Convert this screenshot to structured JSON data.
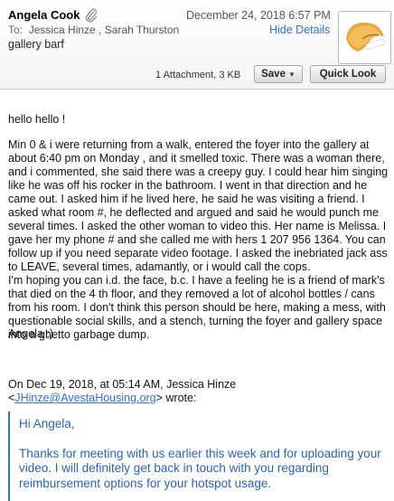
{
  "header": {
    "sender": "Angela Cook",
    "date": "December 24, 2018  6:57 PM",
    "to_label": "To:",
    "recipients": "Jessica Hinze ,  Sarah Thurston",
    "hide_details": "Hide Details",
    "subject": "gallery barf",
    "attachment_info": "1 Attachment, 3 KB",
    "save_label": "Save",
    "quick_look_label": "Quick Look",
    "icons": [
      "paperclip-icon",
      "fortune-cookie-avatar",
      "chevron-down-icon"
    ]
  },
  "body": {
    "greeting": "hello hello !",
    "paragraph1": "Min 0 & i were returning from a walk, entered the foyer into the gallery at about 6:40 pm on Monday , and it smelled toxic. There was a woman there, and i commented, she said there was a creepy guy. I could hear him singing like he was off his rocker in the bathroom. I went in that direction and he came out. I asked him if he lived here, he said he was visiting a friend. I asked what room #, he deflected and argued and said he would punch me several times. I asked the other woman to video this. Her name is Melissa. I gave her my phone # and she called me with hers 1 207 956 1364. You can follow up if you need separate video footage. I asked the inebriated jack ass to LEAVE, several times, adamantly, or i would call the cops.",
    "paragraph2": "I'm hoping you can i.d. the face, b.c. I have a feeling he is a friend of mark's that died on the 4 th floor, and they removed a lot of alcohol bottles / cans from his room. I don't think this person should be here, making a mess, with questionable social skills, and a stench, turning the foyer and gallery space into a ghetto garbage dump.",
    "signoff": "Angela ;)",
    "quote_intro_before": "On Dec 19, 2018, at 05:14 AM, Jessica Hinze <",
    "quote_email": "JHinze@AvestaHousing.org",
    "quote_intro_after": "> wrote:"
  },
  "quote": {
    "greeting": "Hi Angela,",
    "text": "Thanks for meeting with us earlier this week and for uploading your video.  I will definitely get back in touch with you regarding reimbursement options for your hotspot usage."
  },
  "colors": {
    "link_blue": "#2f6fd8",
    "quote_blue": "#2a62b8"
  }
}
